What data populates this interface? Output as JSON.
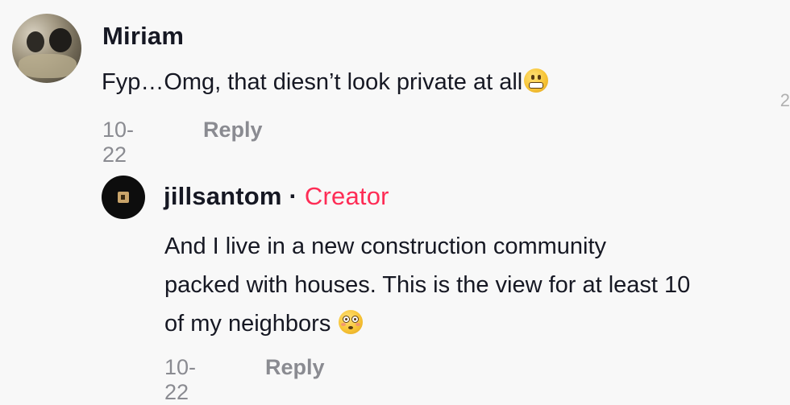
{
  "comments": [
    {
      "username": "Miriam",
      "text": "Fyp…Omg, that diesn’t look private at all",
      "emoji": "grimacing-face-emoji",
      "date": "10-22",
      "reply_label": "Reply"
    }
  ],
  "reply": {
    "username": "jillsantom",
    "separator": "·",
    "badge": "Creator",
    "text_lines": [
      "And I live in a new construction community",
      "packed with houses. This is the view for at least 10",
      "of my neighbors"
    ],
    "emoji": "flushed-face-emoji",
    "date": "10-22",
    "reply_label": "Reply"
  },
  "edge_fragment": "2",
  "colors": {
    "background": "#f8f8f8",
    "text_primary": "#161823",
    "text_secondary": "#8a8b91",
    "creator_accent": "#fe2c55"
  }
}
